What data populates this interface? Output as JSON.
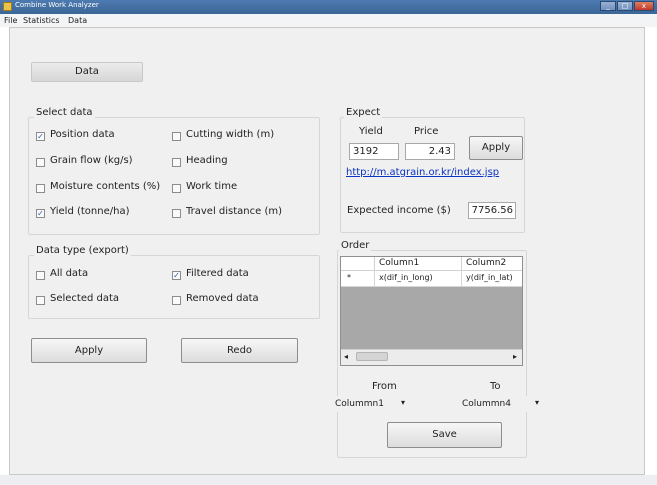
{
  "window": {
    "title": "Combine Work Analyzer",
    "buttons": {
      "minimize": "_",
      "maximize": "□",
      "close": "x"
    }
  },
  "menu": [
    "File",
    "Statistics",
    "Data"
  ],
  "data_tab": "Data",
  "select_data": {
    "title": "Select data",
    "items": [
      {
        "label": "Position data",
        "checked": true
      },
      {
        "label": "Cutting width (m)",
        "checked": false
      },
      {
        "label": "Grain flow (kg/s)",
        "checked": false
      },
      {
        "label": "Heading",
        "checked": false
      },
      {
        "label": "Moisture contents (%)",
        "checked": false
      },
      {
        "label": "Work time",
        "checked": false
      },
      {
        "label": "Yield (tonne/ha)",
        "checked": true
      },
      {
        "label": "Travel distance (m)",
        "checked": false
      }
    ]
  },
  "data_type": {
    "title": "Data type (export)",
    "items": [
      {
        "label": "All data",
        "checked": false
      },
      {
        "label": "Filtered data",
        "checked": true
      },
      {
        "label": "Selected data",
        "checked": false
      },
      {
        "label": "Removed data",
        "checked": false
      }
    ]
  },
  "buttons": {
    "apply": "Apply",
    "redo": "Redo",
    "expect_apply": "Apply",
    "save": "Save"
  },
  "expect": {
    "title": "Expect",
    "yield_label": "Yield",
    "price_label": "Price",
    "yield_value": "3192",
    "price_value": "2.43",
    "link": "http://m.atgrain.or.kr/index.jsp",
    "income_label": "Expected income ($)",
    "income_value": "7756.56"
  },
  "order": {
    "title": "Order",
    "columns": [
      "Column1",
      "Column2"
    ],
    "row_marker": "*",
    "rows": [
      [
        "x(dif_in_long)",
        "y(dif_in_lat)"
      ]
    ],
    "from_label": "From",
    "to_label": "To",
    "from_value": "Colummn1",
    "to_value": "Colummn4"
  },
  "check_glyph": "✓",
  "colors": {
    "titlebar": "#3a6597",
    "link": "#0a34c2",
    "grid_empty": "#a8a8a8"
  }
}
